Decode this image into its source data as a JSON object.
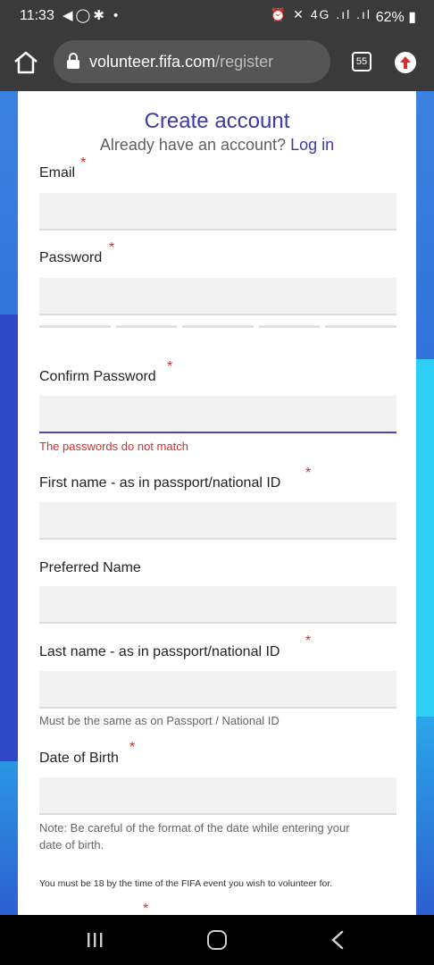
{
  "status_bar": {
    "time": "11:33",
    "left_icons": "◀◯✱ •",
    "right_icons": "⏰ ✕ 4G .ıl .ıl",
    "battery": "62%"
  },
  "browser": {
    "url_domain": "volunteer.fifa.com",
    "url_path": "/register",
    "tab_count": "55"
  },
  "form": {
    "title": "Create account",
    "subtitle_prefix": "Already have an account?",
    "login_link": "Log in",
    "required_marker": "*",
    "email_label": "Email",
    "password_label": "Password",
    "confirm_password_label": "Confirm Password",
    "password_error": "The passwords do not match",
    "first_name_label": "First name - as in passport/national ID",
    "preferred_name_label": "Preferred Name",
    "last_name_label": "Last name - as in passport/national ID",
    "last_name_hint": "Must be the same as on Passport / National ID",
    "dob_label": "Date of Birth",
    "dob_hint_line1": "Note: Be careful of the format of the date while entering your",
    "dob_hint_line2": "date of birth.",
    "age_note": "You must be 18 by the time of the FIFA event you wish to volunteer for."
  },
  "colors": {
    "accent": "#3d3aa8",
    "error": "#d32f2f",
    "toolbar": "#3a3a3a"
  }
}
